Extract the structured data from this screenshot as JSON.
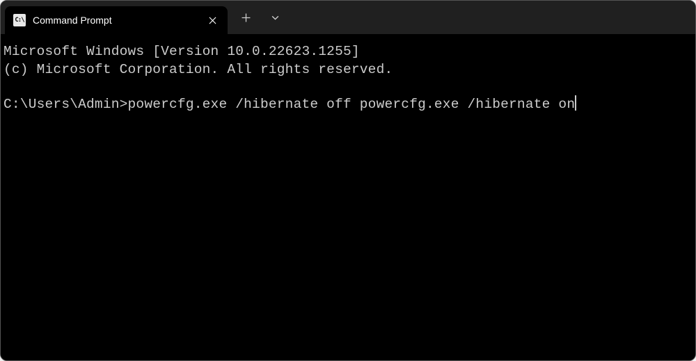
{
  "tab": {
    "title": "Command Prompt",
    "icon_label": "C:\\"
  },
  "terminal": {
    "line1": "Microsoft Windows [Version 10.0.22623.1255]",
    "line2": "(c) Microsoft Corporation. All rights reserved.",
    "prompt": "C:\\Users\\Admin>",
    "command": "powercfg.exe /hibernate off powercfg.exe /hibernate on"
  }
}
